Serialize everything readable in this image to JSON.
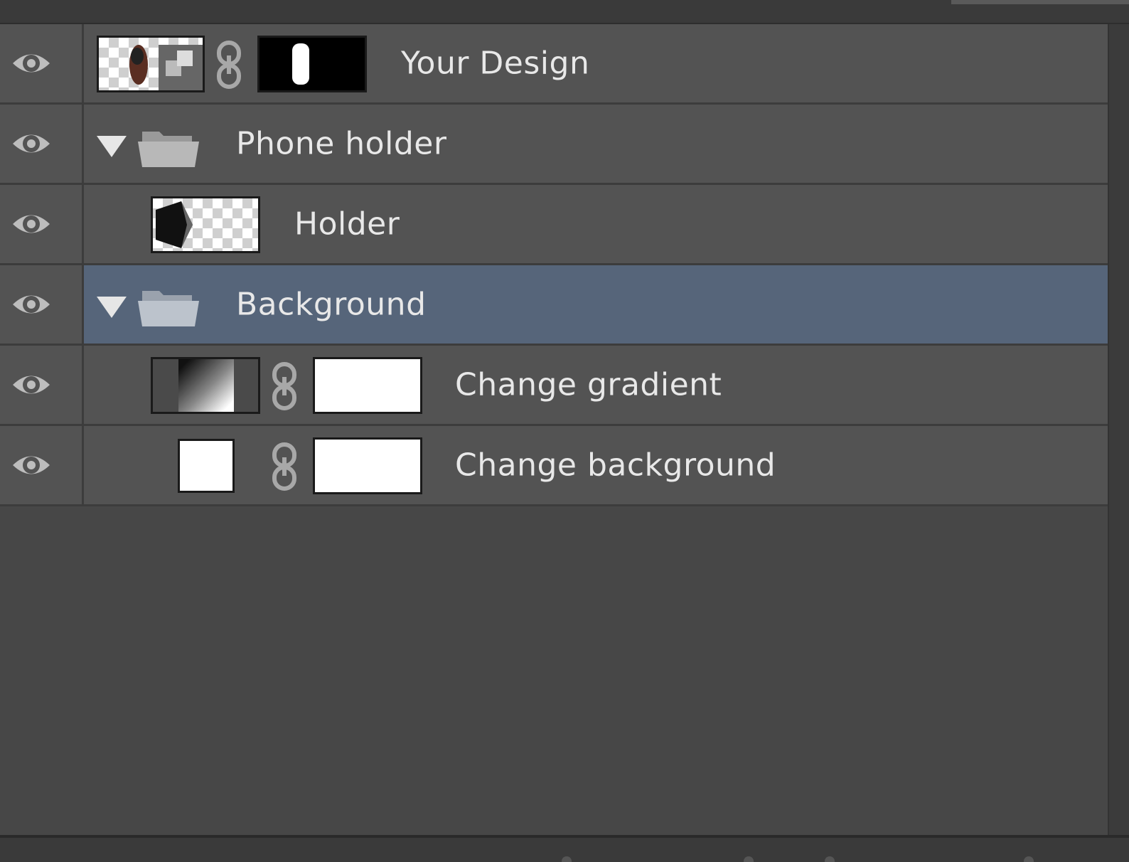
{
  "layers_panel": {
    "layers": [
      {
        "name": "Your Design",
        "type": "smart-object",
        "visible": true,
        "linked_mask": true
      },
      {
        "name": "Phone holder",
        "type": "group",
        "expanded": true,
        "visible": true
      },
      {
        "name": "Holder",
        "type": "layer",
        "visible": true
      },
      {
        "name": "Background",
        "type": "group",
        "expanded": true,
        "visible": true,
        "selected": true
      },
      {
        "name": "Change gradient",
        "type": "adjustment-gradient",
        "visible": true,
        "linked_mask": true
      },
      {
        "name": "Change background",
        "type": "fill",
        "visible": true,
        "linked_mask": true
      }
    ]
  },
  "colors": {
    "row_bg": "#535353",
    "selected_bg": "#56657a",
    "panel_bg": "#474747",
    "text": "#e8e8e8"
  },
  "icons": [
    "eye-icon",
    "chain-link-icon",
    "folder-icon",
    "disclosure-triangle-icon"
  ]
}
